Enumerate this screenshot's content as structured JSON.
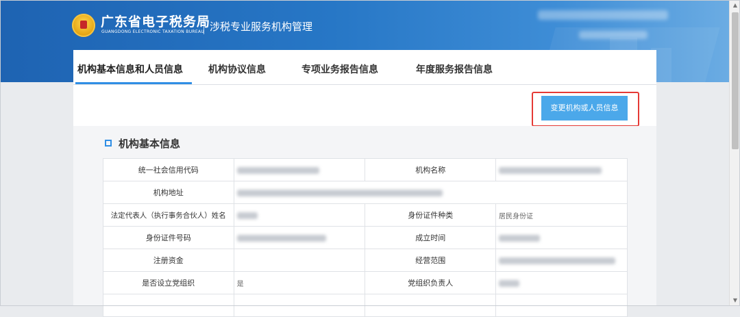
{
  "header": {
    "bureau_name": "广东省电子税务局",
    "bureau_name_en": "GUANGDONG ELECTRONIC TAXATION BUREAU",
    "system_name": "涉税专业服务机构管理"
  },
  "tabs": [
    {
      "label": "机构基本信息和人员信息",
      "active": true
    },
    {
      "label": "机构协议信息",
      "active": false
    },
    {
      "label": "专项业务报告信息",
      "active": false
    },
    {
      "label": "年度服务报告信息",
      "active": false
    }
  ],
  "toolbar": {
    "change_button": "变更机构或人员信息"
  },
  "section": {
    "title": "机构基本信息"
  },
  "info_table": {
    "rows": [
      {
        "label1": "统一社会信用代码",
        "value1": "",
        "label2": "机构名称",
        "value2": ""
      },
      {
        "label1": "机构地址",
        "value1": ""
      },
      {
        "label1": "法定代表人（执行事务合伙人）姓名",
        "value1": "",
        "label2": "身份证件种类",
        "value2": "居民身份证"
      },
      {
        "label1": "身份证件号码",
        "value1": "",
        "label2": "成立时间",
        "value2": ""
      },
      {
        "label1": "注册资金",
        "value1": "",
        "label2": "经营范围",
        "value2": ""
      },
      {
        "label1": "是否设立党组织",
        "value1": "是",
        "label2": "党组织负责人",
        "value2": ""
      }
    ]
  },
  "colors": {
    "header_blue": "#1e63b2",
    "accent_blue": "#2f8ee5",
    "button_blue": "#4ba8ea",
    "highlight_red": "#e53935"
  }
}
